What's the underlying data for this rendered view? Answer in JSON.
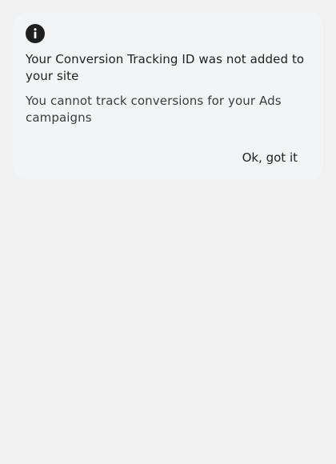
{
  "dialog": {
    "icon": "info-icon",
    "title": "Your Conversion Tracking ID was not added to your site",
    "message": "You cannot track conversions for your Ads campaigns",
    "confirm_label": "Ok, got it"
  },
  "colors": {
    "page_background": "#f0f0f0",
    "card_background": "#f3f4f6",
    "icon": "#1f1f1f",
    "text_primary": "#1f1f1f",
    "text_secondary": "#3c3c3c"
  }
}
